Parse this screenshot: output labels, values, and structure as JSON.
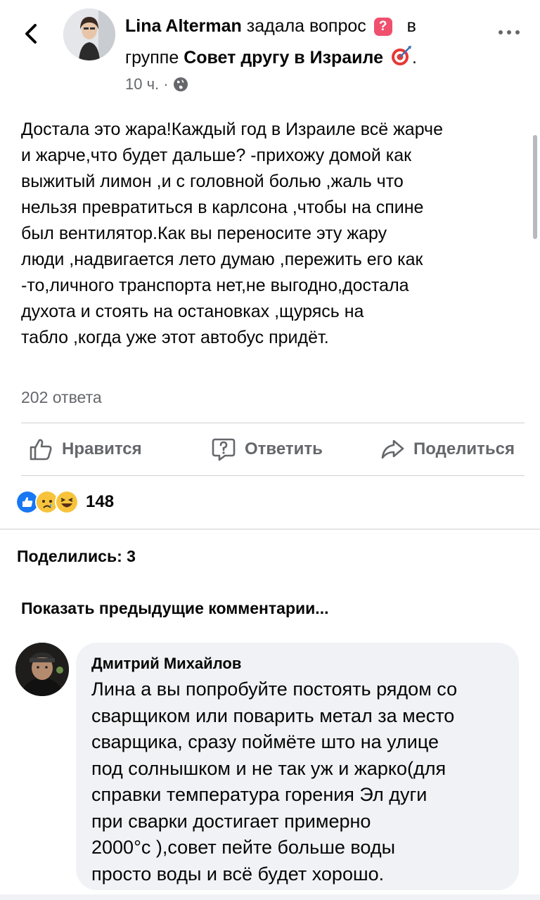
{
  "post": {
    "author": "Lina Alterman",
    "action_text": "задала вопрос",
    "in_text": "в",
    "group_prefix": "группе",
    "group_name": "Совет другу в Израиле",
    "group_suffix": ".",
    "time": "10 ч. ·",
    "text": "Достала это жара!Каждый год в Израиле всё жарче\nи жарче,что будет дальше? -прихожу домой как\nвыжитый лимон ,и с головной болью ,жаль что\nнельзя превратиться в карлсона ,чтобы на спине\nбыл вентилятор.Как вы переносите эту жару\nлюди ,надвигается лето думаю ,пережить его как\n-то,личного транспорта нет,не выгодно,достала\nдухота и стоять на остановках ,щурясь на\nтабло ,когда уже этот автобус придёт.",
    "answers_count": "202 ответа"
  },
  "actions": {
    "like": "Нравится",
    "reply": "Ответить",
    "share": "Поделиться"
  },
  "reactions": {
    "icons": [
      "like-icon",
      "sad-icon",
      "haha-icon"
    ],
    "count": "148"
  },
  "shares": "Поделились: 3",
  "show_previous": "Показать предыдущие комментарии...",
  "comment": {
    "author": "Дмитрий Михайлов",
    "text": "Лина а вы попробуйте постоять рядом со\nсварщиком или поварить метал за место\nсварщика, сразу поймёте што на улице\nпод солнышком и не так уж и жарко(для\nсправки температура горения Эл дуги\nпри сварки достигает примерно\n2000°c ),совет пейте больше воды\nпросто воды и всё будет хорошо."
  },
  "colors": {
    "text": "#050505",
    "secondary": "#65676b",
    "like_blue": "#1877f2",
    "question_badge": "#f0506e",
    "bubble": "#f0f2f5"
  }
}
